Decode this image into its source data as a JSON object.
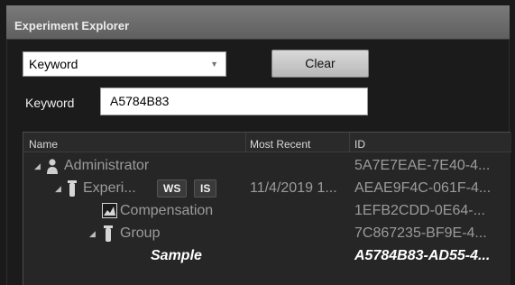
{
  "window": {
    "title": "Experiment Explorer"
  },
  "search": {
    "mode_selected": "Keyword",
    "clear_label": "Clear",
    "keyword_label": "Keyword",
    "keyword_value": "A5784B83"
  },
  "grid": {
    "columns": {
      "name": "Name",
      "most_recent": "Most Recent",
      "id": "ID"
    },
    "rows": [
      {
        "name": "Administrator",
        "most_recent": "",
        "id": "5A7E7EAE-7E40-4...",
        "icon": "user-icon"
      },
      {
        "name": "Experi...",
        "badges": [
          "WS",
          "IS"
        ],
        "most_recent": "11/4/2019 1...",
        "id": "AEAE9F4C-061F-4...",
        "icon": "tube-icon"
      },
      {
        "name": "Compensation",
        "most_recent": "",
        "id": "1EFB2CDD-0E64-...",
        "icon": "chart-icon"
      },
      {
        "name": "Group",
        "most_recent": "",
        "id": "7C867235-BF9E-4...",
        "icon": "tube-icon"
      },
      {
        "name": "Sample",
        "most_recent": "",
        "id": "A5784B83-AD55-4...",
        "icon": ""
      }
    ]
  }
}
